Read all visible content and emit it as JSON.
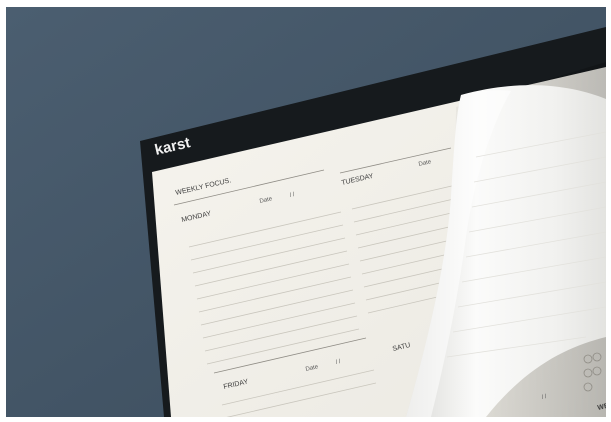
{
  "photo": {
    "subject": "weekly planner pad on a slate blue surface",
    "colors": {
      "background": "#435566",
      "pad_border": "#161a1d",
      "paper": "#f4f2ec",
      "curl_paper": "#f8f8f6",
      "rule_line": "#c9c6bd",
      "ink": "#3c3c3c"
    }
  },
  "planner": {
    "brand": "karst",
    "focus_label": "WEEKLY FOCUS.",
    "date_label": "Date",
    "date_separators": "/     /",
    "days": {
      "monday": "MONDAY",
      "tuesday": "TUESDAY",
      "friday": "FRIDAY",
      "saturday_partial": "SATU",
      "sunday_partial": "WE"
    }
  }
}
